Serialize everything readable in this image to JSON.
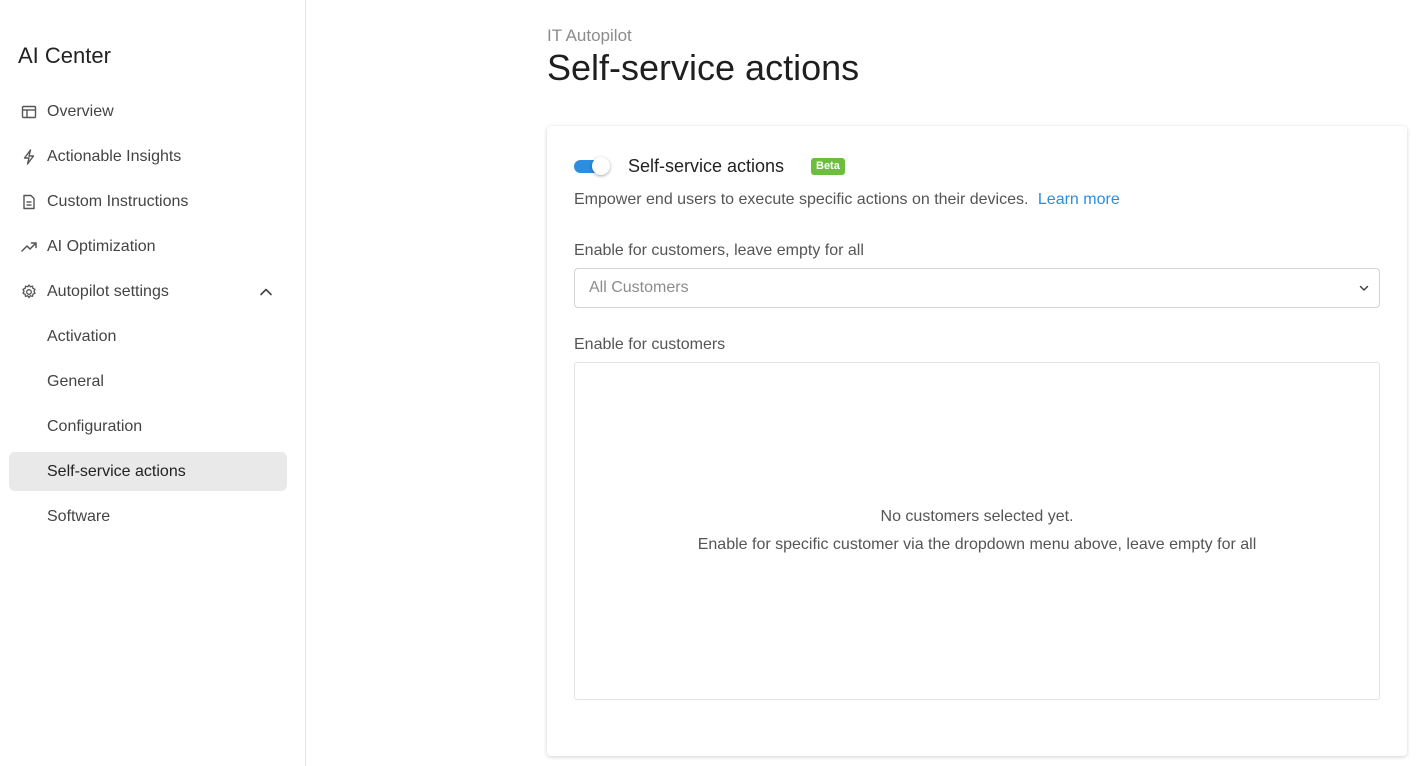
{
  "sidebar": {
    "title": "AI Center",
    "items": [
      {
        "label": "Overview",
        "icon": "layout-icon"
      },
      {
        "label": "Actionable Insights",
        "icon": "lightning-icon"
      },
      {
        "label": "Custom Instructions",
        "icon": "document-icon"
      },
      {
        "label": "AI Optimization",
        "icon": "trending-up-icon"
      },
      {
        "label": "Autopilot settings",
        "icon": "gear-icon",
        "expanded": true
      },
      {
        "label": "Activation"
      },
      {
        "label": "General"
      },
      {
        "label": "Configuration"
      },
      {
        "label": "Self-service actions",
        "active": true
      },
      {
        "label": "Software"
      }
    ]
  },
  "header": {
    "breadcrumb": "IT Autopilot",
    "title": "Self-service actions"
  },
  "card": {
    "toggle_on": true,
    "title": "Self-service actions",
    "badge": "Beta",
    "description": "Empower end users to execute specific actions on their devices.",
    "learn_more": "Learn more",
    "select_label": "Enable for customers, leave empty for all",
    "select_placeholder": "All Customers",
    "list_label": "Enable for customers",
    "empty_title": "No customers selected yet.",
    "empty_hint": "Enable for specific customer via the dropdown menu above, leave empty for all"
  },
  "colors": {
    "accent": "#2b8ee0",
    "badge": "#6cbf3c",
    "active_nav_bg": "#e9e9e9"
  }
}
